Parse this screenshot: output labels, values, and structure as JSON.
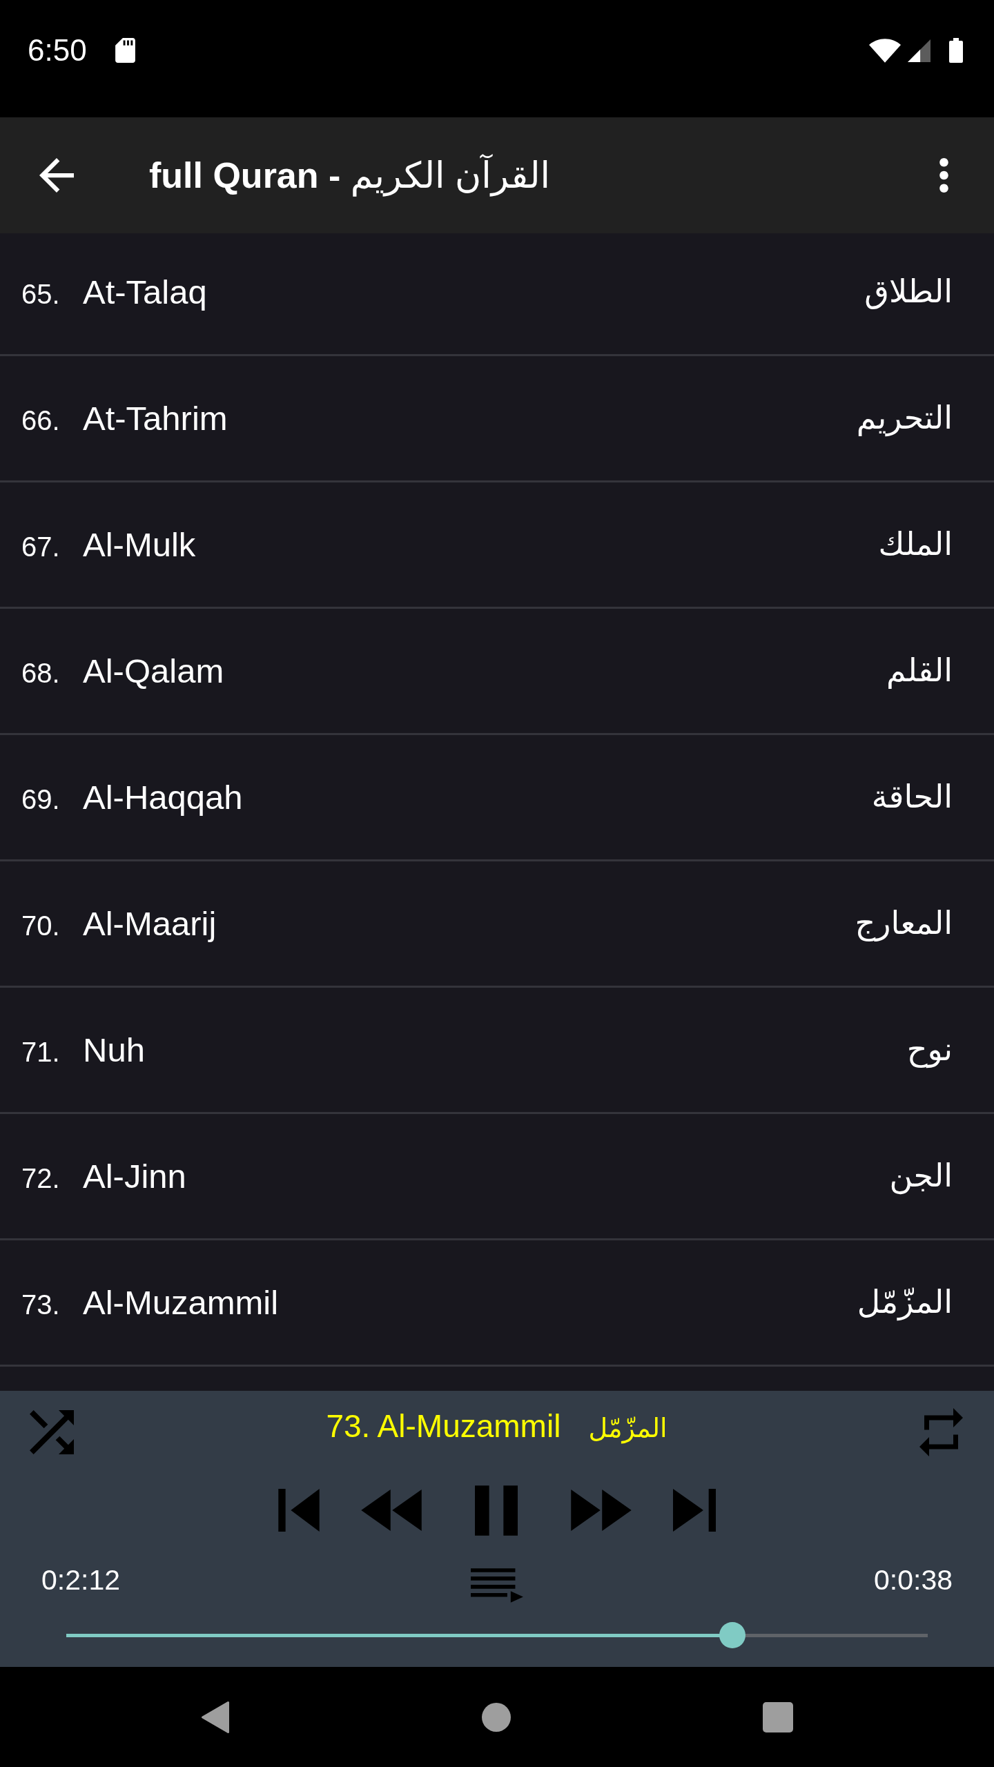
{
  "status_bar": {
    "time": "6:50"
  },
  "toolbar": {
    "title": "**full Quran -** القرآن الكريم"
  },
  "surahs": [
    {
      "number": "65.",
      "name": "At-Talaq",
      "arabic": "الطلاق"
    },
    {
      "number": "66.",
      "name": "At-Tahrim",
      "arabic": "التحريم"
    },
    {
      "number": "67.",
      "name": "Al-Mulk",
      "arabic": "الملك"
    },
    {
      "number": "68.",
      "name": "Al-Qalam",
      "arabic": "القلم"
    },
    {
      "number": "69.",
      "name": "Al-Haqqah",
      "arabic": "الحاقة"
    },
    {
      "number": "70.",
      "name": "Al-Maarij",
      "arabic": "المعارج"
    },
    {
      "number": "71.",
      "name": "Nuh",
      "arabic": "نوح"
    },
    {
      "number": "72.",
      "name": "Al-Jinn",
      "arabic": "الجن"
    },
    {
      "number": "73.",
      "name": "Al-Muzammil",
      "arabic": "المزّمّل"
    }
  ],
  "player": {
    "title": "73. Al-Muzammil",
    "arabic_title": "المزّمّل",
    "playing": true,
    "elapsed": "0:2:12",
    "remaining": "0:0:38",
    "level": 0.773
  }
}
